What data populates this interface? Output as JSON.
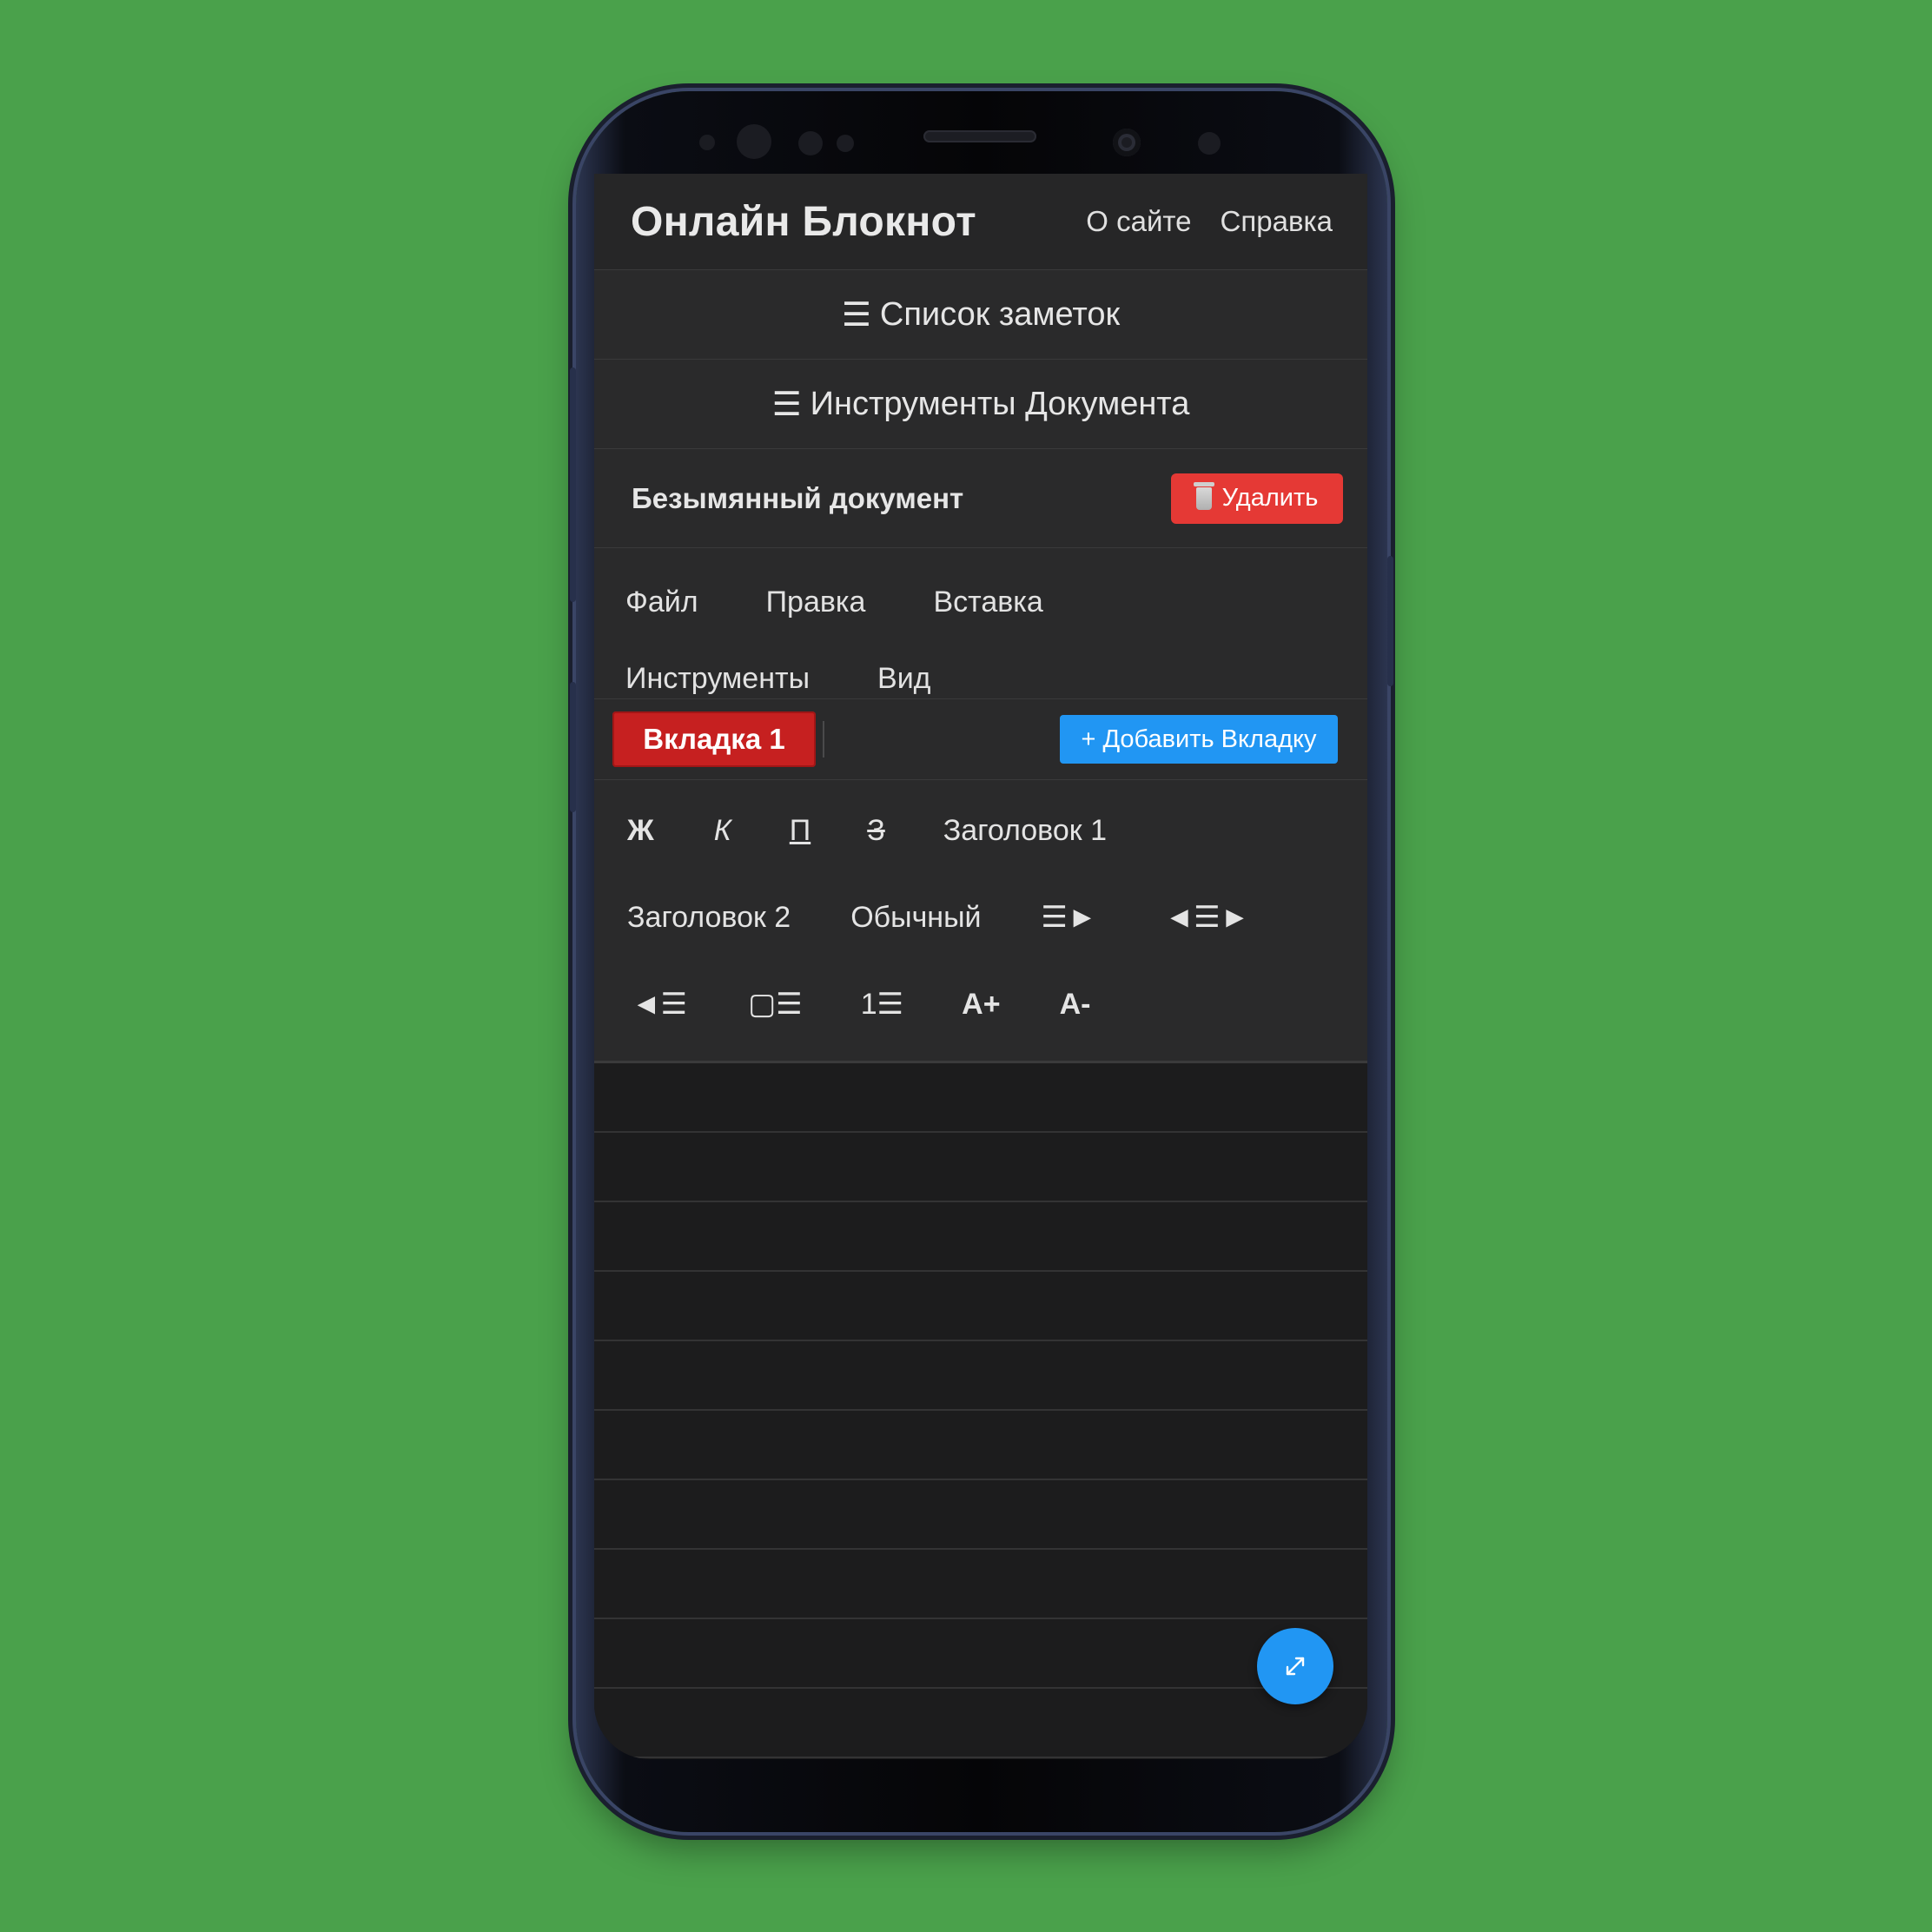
{
  "app": {
    "title": "Онлайн Блокнот",
    "nav": [
      "О сайте",
      "Справка"
    ]
  },
  "sections": {
    "notes_list": {
      "icon": "☰",
      "label": "Список заметок"
    },
    "doc_tools": {
      "icon": "☰",
      "label": "Инструменты Документа"
    }
  },
  "document": {
    "title": "Безымянный документ",
    "delete_label": "Удалить"
  },
  "menu": {
    "row1": [
      "Файл",
      "Правка",
      "Вставка"
    ],
    "row2": [
      "Инструменты",
      "Вид"
    ]
  },
  "tabs": {
    "active": "Вкладка 1",
    "add_label": "+ Добавить Вкладку"
  },
  "format": {
    "bold": "Ж",
    "italic": "К",
    "underline": "П",
    "strike": "З",
    "h1": "Заголовок 1",
    "h2": "Заголовок 2",
    "normal": "Обычный",
    "align_right": "☰►",
    "align_center": "◄☰►",
    "align_left": "◄☰",
    "bullet_list": "▢☰",
    "numbered_list": "1☰",
    "font_increase": "A+",
    "font_decrease": "A-"
  },
  "colors": {
    "background": "#4aa14b",
    "delete": "#e53935",
    "tab_active": "#c62020",
    "accent": "#2196f3"
  },
  "icons": {
    "fab": "expand-arrows-icon",
    "delete": "trash-icon"
  }
}
